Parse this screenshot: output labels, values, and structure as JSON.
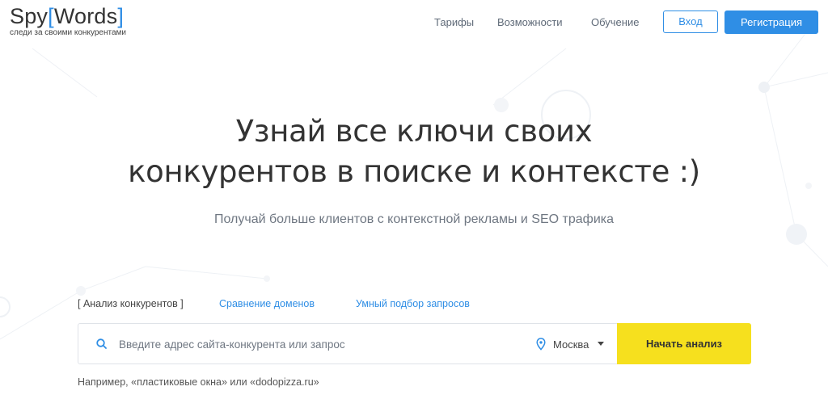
{
  "header": {
    "logo": {
      "prefix": "Spy",
      "bracket_open": "[",
      "word": "Words",
      "bracket_close": "]",
      "tagline": "следи за своими конкурентами"
    },
    "nav": [
      {
        "label": "Тарифы"
      },
      {
        "label": "Возможности"
      },
      {
        "label": "Обучение"
      }
    ],
    "login_label": "Вход",
    "register_label": "Регистрация"
  },
  "hero": {
    "title_line1": "Узнай все ключи своих",
    "title_line2": "конкурентов в поиске и контексте :)",
    "subtitle": "Получай больше клиентов с контекстной рекламы и SEO трафика"
  },
  "tabs": [
    {
      "label": "[ Анализ конкурентов ]",
      "active": true
    },
    {
      "label": "Сравнение доменов",
      "active": false
    },
    {
      "label": "Умный подбор запросов",
      "active": false
    }
  ],
  "search": {
    "placeholder": "Введите адрес сайта-конкурента или запрос",
    "value": "",
    "city": "Москва",
    "button_label": "Начать анализ"
  },
  "example": {
    "prefix": "Например,",
    "q1": "«пластиковые окна»",
    "middle": "или",
    "q2": "«dodopizza.ru»"
  },
  "colors": {
    "accent": "#2f8ee5",
    "button_yellow": "#f6e01e"
  },
  "icons": [
    "search-icon",
    "location-pin-icon",
    "caret-down-icon"
  ]
}
